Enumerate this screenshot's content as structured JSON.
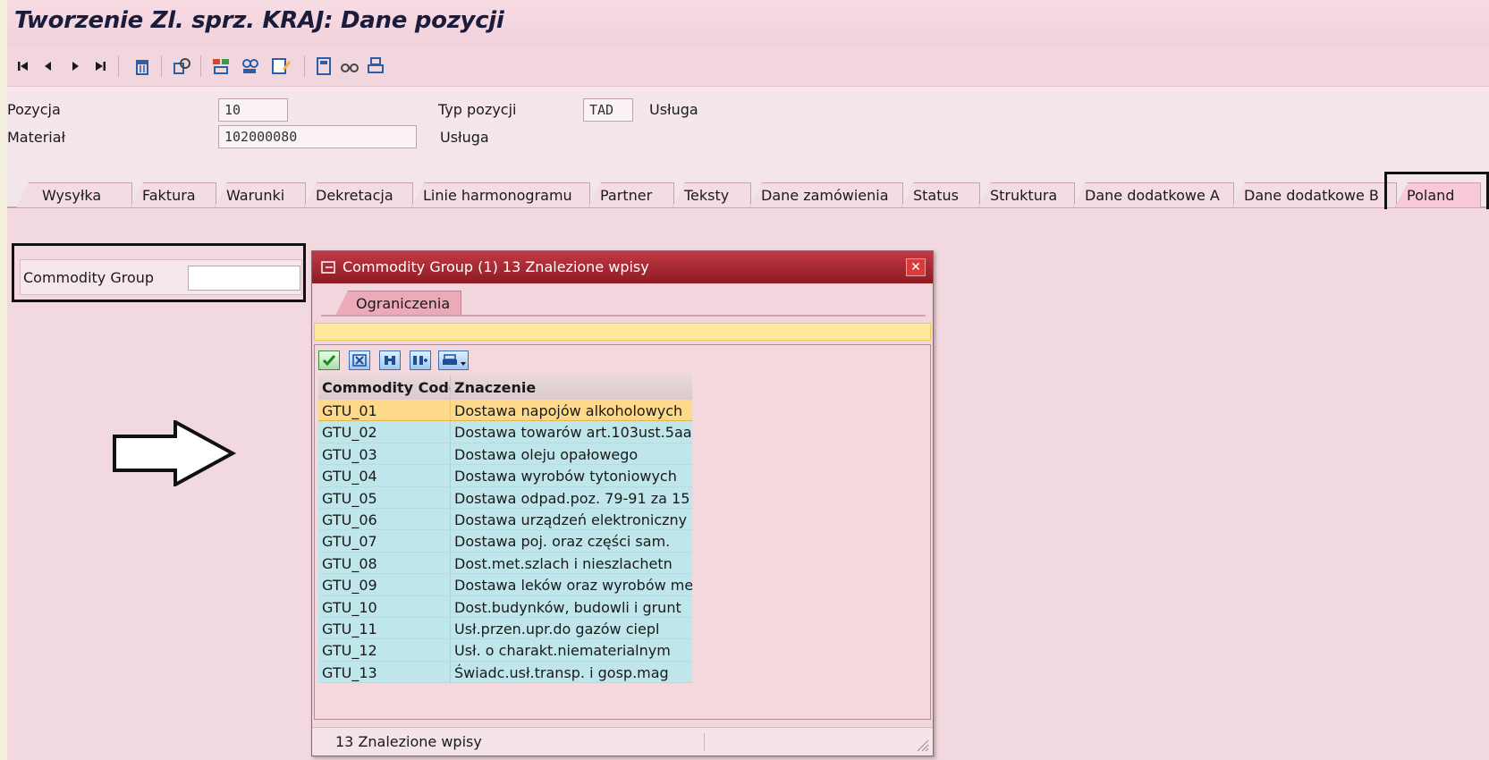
{
  "window": {
    "title": "Tworzenie Zl. sprz. KRAJ: Dane pozycji"
  },
  "toolbar": {
    "icons": [
      "first-page-icon",
      "prev-page-icon",
      "next-page-icon",
      "last-page-icon",
      "delete-icon",
      "display-object-icon",
      "item-overview-icon",
      "header-overview-icon",
      "edit-details-icon",
      "calculator-icon",
      "glasses-icon",
      "print-icon"
    ]
  },
  "header": {
    "item_label": "Pozycja",
    "item_value": "10",
    "item_type_label": "Typ pozycji",
    "item_type_value": "TAD",
    "item_type_desc": "Usługa",
    "material_label": "Materiał",
    "material_value": "102000080",
    "material_desc": "Usługa"
  },
  "tabs": [
    {
      "label": "Wysyłka"
    },
    {
      "label": "Faktura"
    },
    {
      "label": "Warunki"
    },
    {
      "label": "Dekretacja"
    },
    {
      "label": "Linie harmonogramu"
    },
    {
      "label": "Partner"
    },
    {
      "label": "Teksty"
    },
    {
      "label": "Dane zamówienia"
    },
    {
      "label": "Status"
    },
    {
      "label": "Struktura"
    },
    {
      "label": "Dane dodatkowe A"
    },
    {
      "label": "Dane dodatkowe B"
    },
    {
      "label": "Poland"
    }
  ],
  "active_tab": "Poland",
  "poland_tab": {
    "commodity_group_label": "Commodity Group",
    "commodity_group_value": ""
  },
  "popup": {
    "title": "Commodity Group (1)   13 Znalezione wpisy",
    "subtab_label": "Ograniczenia",
    "columns": [
      "Commodity Code",
      "Znaczenie"
    ],
    "rows": [
      {
        "code": "GTU_01",
        "meaning": "Dostawa napojów alkoholowych",
        "selected": true
      },
      {
        "code": "GTU_02",
        "meaning": "Dostawa towarów art.103ust.5aa"
      },
      {
        "code": "GTU_03",
        "meaning": "Dostawa oleju opałowego"
      },
      {
        "code": "GTU_04",
        "meaning": "Dostawa wyrobów tytoniowych"
      },
      {
        "code": "GTU_05",
        "meaning": "Dostawa odpad.poz. 79-91 za 15"
      },
      {
        "code": "GTU_06",
        "meaning": "Dostawa urządzeń elektroniczny"
      },
      {
        "code": "GTU_07",
        "meaning": "Dostawa poj. oraz części sam."
      },
      {
        "code": "GTU_08",
        "meaning": "Dost.met.szlach i nieszlachetn"
      },
      {
        "code": "GTU_09",
        "meaning": "Dostawa leków oraz wyrobów med"
      },
      {
        "code": "GTU_10",
        "meaning": "Dost.budynków, budowli i grunt"
      },
      {
        "code": "GTU_11",
        "meaning": "Usł.przen.upr.do gazów ciepl"
      },
      {
        "code": "GTU_12",
        "meaning": "Usł. o charakt.niematerialnym"
      },
      {
        "code": "GTU_13",
        "meaning": "Świadc.usł.transp. i gosp.mag"
      }
    ],
    "status_text": "13 Znalezione wpisy"
  },
  "colors": {
    "title_text": "#1b1b3a",
    "popup_header": "#a82531",
    "selected_row": "#ffd98a",
    "list_row": "#bfe6ea"
  }
}
